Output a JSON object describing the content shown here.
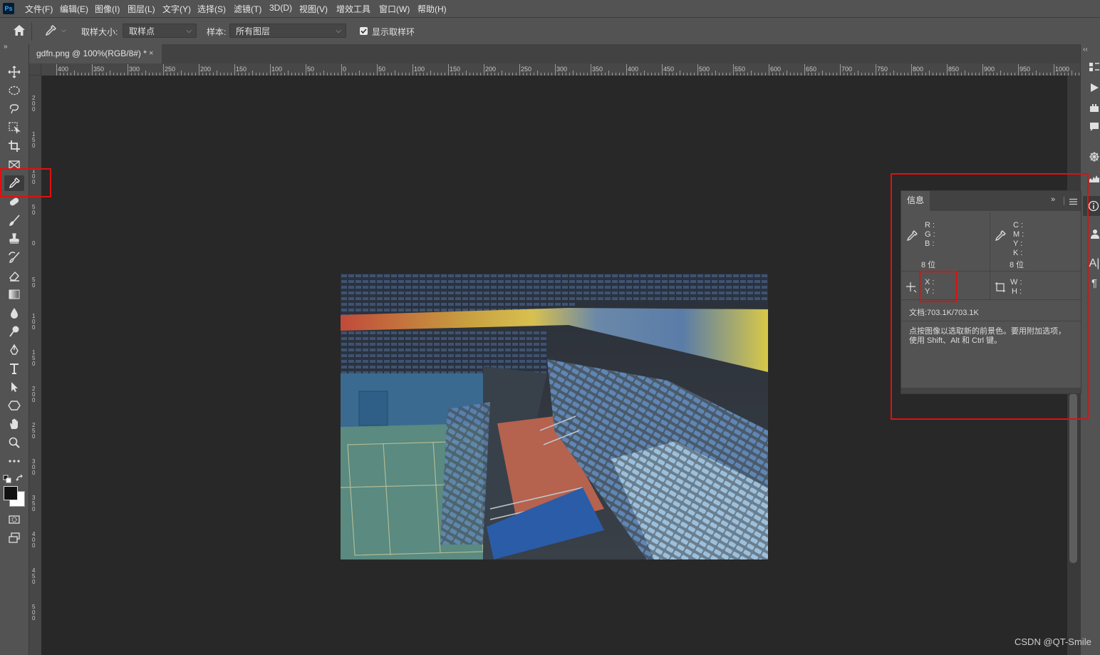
{
  "app": {
    "logo": "Ps"
  },
  "menu": [
    "文件(F)",
    "编辑(E)",
    "图像(I)",
    "图层(L)",
    "文字(Y)",
    "选择(S)",
    "滤镜(T)",
    "3D(D)",
    "视图(V)",
    "增效工具",
    "窗口(W)",
    "帮助(H)"
  ],
  "options": {
    "sample_size_label": "取样大小:",
    "sample_size_value": "取样点",
    "sample_label": "样本:",
    "sample_value": "所有图层",
    "show_ring_label": "显示取样环",
    "show_ring_checked": true
  },
  "document": {
    "tab_title": "gdfn.png @ 100%(RGB/8#) *",
    "close": "×"
  },
  "ruler": {
    "h_ticks": [
      "400",
      "350",
      "300",
      "250",
      "200",
      "150",
      "100",
      "50",
      "0",
      "50",
      "100",
      "150",
      "200",
      "250",
      "300",
      "350",
      "400",
      "450",
      "500",
      "550",
      "600",
      "650",
      "700",
      "750",
      "800",
      "850",
      "900",
      "950",
      "1000"
    ],
    "v_ticks": [
      "200",
      "150",
      "100",
      "50",
      "0",
      "50",
      "100",
      "150",
      "200",
      "250",
      "300",
      "350",
      "400",
      "450",
      "500"
    ]
  },
  "info_panel": {
    "tab": "信息",
    "rgb": {
      "r": "R :",
      "g": "G :",
      "b": "B :",
      "bits": "8 位"
    },
    "cmyk": {
      "c": "C :",
      "m": "M :",
      "y": "Y :",
      "k": "K :",
      "bits": "8 位"
    },
    "xy": {
      "x": "X :",
      "y": "Y :"
    },
    "wh": {
      "w": "W :",
      "h": "H :"
    },
    "doc": "文档:703.1K/703.1K",
    "hint": "点按图像以选取新的前景色。要用附加选项，使用 Shift、Alt 和 Ctrl 键。"
  },
  "watermark": "CSDN @QT-Smile",
  "colors": {
    "highlight": "#e01010",
    "panel_bg": "#535353",
    "canvas_bg": "#282828"
  }
}
